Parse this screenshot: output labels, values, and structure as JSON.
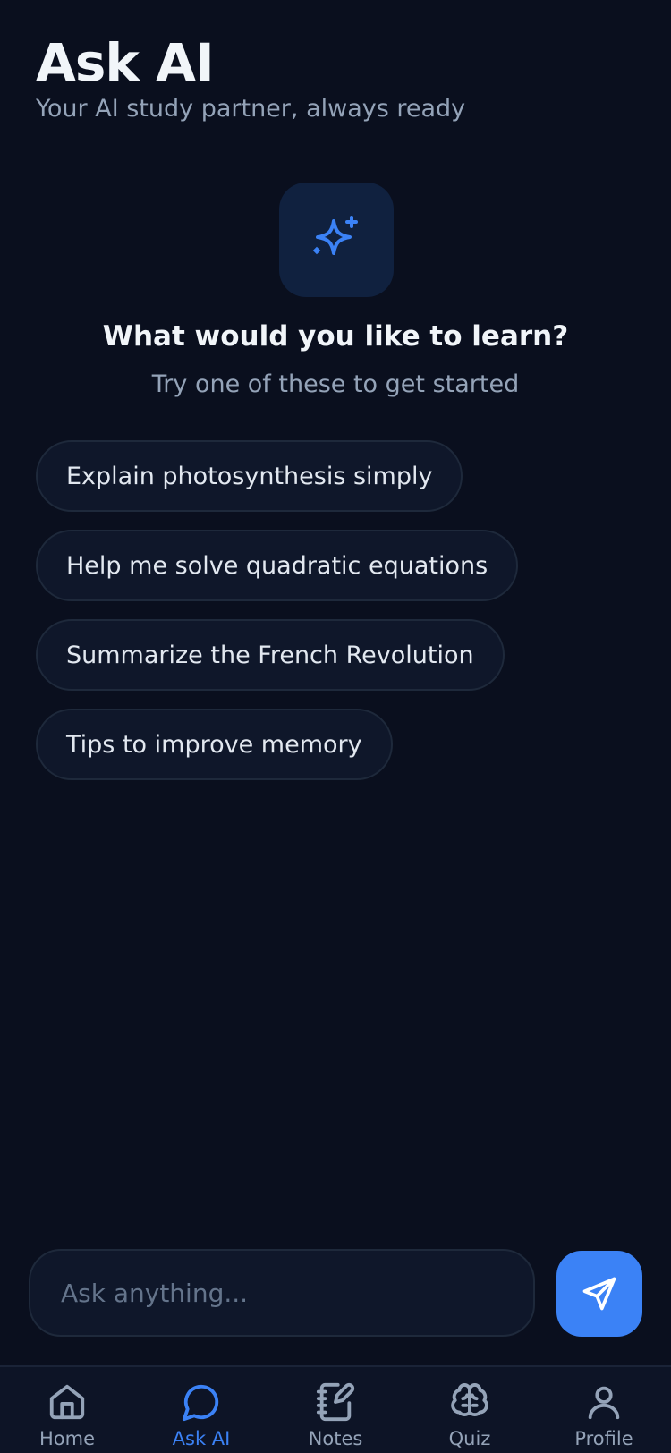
{
  "header": {
    "title": "Ask AI",
    "subtitle": "Your AI study partner, always ready"
  },
  "hero": {
    "icon": "sparkles-icon",
    "title": "What would you like to learn?",
    "subtitle": "Try one of these to get started"
  },
  "suggestions": [
    {
      "label": "Explain photosynthesis simply"
    },
    {
      "label": "Help me solve quadratic equations"
    },
    {
      "label": "Summarize the French Revolution"
    },
    {
      "label": "Tips to improve memory"
    }
  ],
  "composer": {
    "placeholder": "Ask anything...",
    "value": "",
    "send_icon": "send-icon"
  },
  "tabs": [
    {
      "label": "Home",
      "icon": "home-icon",
      "active": false
    },
    {
      "label": "Ask AI",
      "icon": "chat-bubble-icon",
      "active": true
    },
    {
      "label": "Notes",
      "icon": "notes-icon",
      "active": false
    },
    {
      "label": "Quiz",
      "icon": "brain-icon",
      "active": false
    },
    {
      "label": "Profile",
      "icon": "user-icon",
      "active": false
    }
  ],
  "colors": {
    "background": "#0a0f1e",
    "accent": "#3b82f6",
    "muted_text": "#94a3b8",
    "surface": "#0f172a"
  }
}
